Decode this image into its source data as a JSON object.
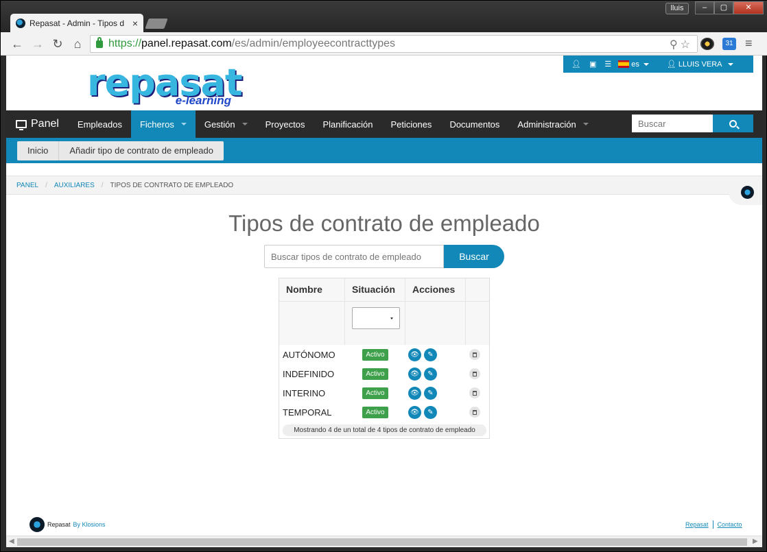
{
  "browser": {
    "tab_title": "Repasat - Admin - Tipos d",
    "tab_close": "×",
    "profile_name": "lluis",
    "url_scheme": "https://",
    "url_host": "panel.repasat.com",
    "url_path": "/es/admin/employeecontracttypes",
    "ext2_label": "31"
  },
  "topbar": {
    "lang": "es",
    "user": "LLUIS VERA"
  },
  "logo": {
    "word": "repasat",
    "sub": "e-learning"
  },
  "nav": {
    "brand": "Panel",
    "items": [
      {
        "label": "Empleados"
      },
      {
        "label": "Ficheros"
      },
      {
        "label": "Gestión"
      },
      {
        "label": "Proyectos"
      },
      {
        "label": "Planificación"
      },
      {
        "label": "Peticiones"
      },
      {
        "label": "Documentos"
      },
      {
        "label": "Administración"
      }
    ],
    "search_placeholder": "Buscar"
  },
  "subnav": {
    "home": "Inicio",
    "add": "Añadir tipo de contrato de empleado"
  },
  "breadcrumb": {
    "items": [
      "PANEL",
      "AUXILIARES",
      "TIPOS DE CONTRATO DE EMPLEADO"
    ],
    "sep": "/"
  },
  "page": {
    "title": "Tipos de contrato de empleado",
    "search_placeholder": "Buscar tipos de contrato de empleado",
    "search_button": "Buscar"
  },
  "table": {
    "headers": [
      "Nombre",
      "Situación",
      "Acciones",
      ""
    ],
    "rows": [
      {
        "name": "AUTÓNOMO",
        "status": "Activo"
      },
      {
        "name": "INDEFINIDO",
        "status": "Activo"
      },
      {
        "name": "INTERINO",
        "status": "Activo"
      },
      {
        "name": "TEMPORAL",
        "status": "Activo"
      }
    ],
    "summary": "Mostrando 4 de un total de 4 tipos de contrato de empleado"
  },
  "footer": {
    "name": "Repasat",
    "by": "By Klosions",
    "link1": "Repasat",
    "link2": "Contacto"
  },
  "colors": {
    "accent": "#1288b8",
    "nav_bg": "#2a2a2a",
    "status_active": "#3ea04a"
  },
  "icons": [
    "favicon",
    "back-arrow-icon",
    "forward-arrow-icon",
    "reload-icon",
    "home-icon",
    "lock-icon",
    "search-icon",
    "star-icon",
    "user-icon",
    "briefcase-icon",
    "list-icon",
    "flag-es-icon",
    "monitor-icon",
    "eye-icon",
    "pencil-icon",
    "trash-icon",
    "menu-icon"
  ]
}
